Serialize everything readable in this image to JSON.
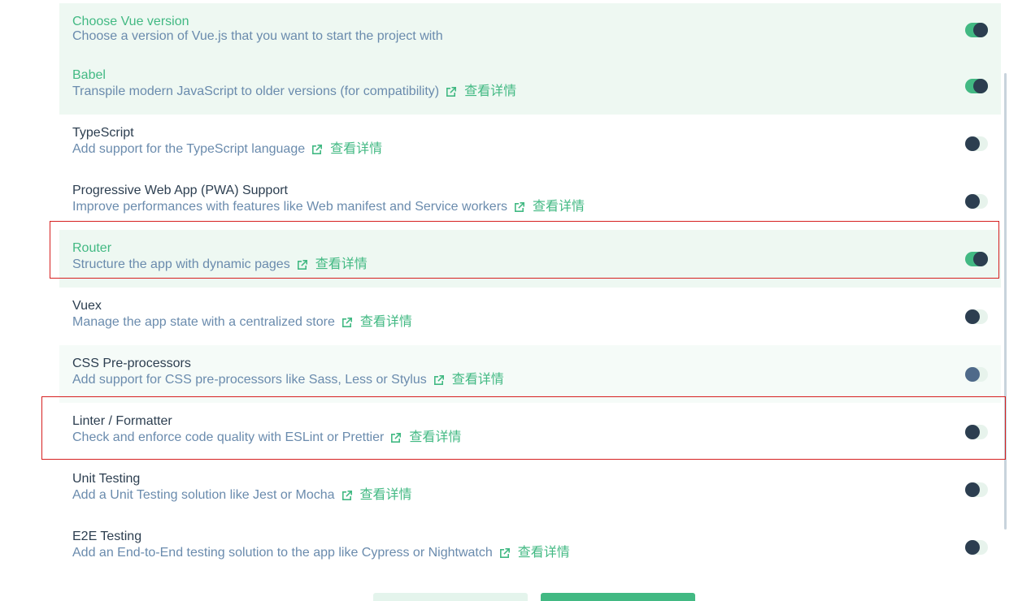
{
  "features": [
    {
      "title": "Choose Vue version",
      "description": "Choose a version of Vue.js that you want to start the project with",
      "link": "",
      "enabled": true,
      "selected": true
    },
    {
      "title": "Babel",
      "description": "Transpile modern JavaScript to older versions (for compatibility)",
      "link": "查看详情",
      "enabled": true,
      "selected": true
    },
    {
      "title": "TypeScript",
      "description": "Add support for the TypeScript language",
      "link": "查看详情",
      "enabled": false,
      "selected": false
    },
    {
      "title": "Progressive Web App (PWA) Support",
      "description": "Improve performances with features like Web manifest and Service workers",
      "link": "查看详情",
      "enabled": false,
      "selected": false
    },
    {
      "title": "Router",
      "description": "Structure the app with dynamic pages",
      "link": "查看详情",
      "enabled": true,
      "selected": true
    },
    {
      "title": "Vuex",
      "description": "Manage the app state with a centralized store",
      "link": "查看详情",
      "enabled": false,
      "selected": false
    },
    {
      "title": "CSS Pre-processors",
      "description": "Add support for CSS pre-processors like Sass, Less or Stylus",
      "link": "查看详情",
      "enabled": false,
      "selected": false
    },
    {
      "title": "Linter / Formatter",
      "description": "Check and enforce code quality with ESLint or Prettier",
      "link": "查看详情",
      "enabled": false,
      "selected": false
    },
    {
      "title": "Unit Testing",
      "description": "Add a Unit Testing solution like Jest or Mocha",
      "link": "查看详情",
      "enabled": false,
      "selected": false
    },
    {
      "title": "E2E Testing",
      "description": "Add an End-to-End testing solution to the app like Cypress or Nightwatch",
      "link": "查看详情",
      "enabled": false,
      "selected": false
    }
  ],
  "colors": {
    "accent": "#42b983",
    "text": "#2c3e50",
    "description": "#6a8bad",
    "selected_bg": "#eef8f2",
    "annotation": "#d62020"
  },
  "icons": {
    "external_link": "external-link-icon"
  }
}
